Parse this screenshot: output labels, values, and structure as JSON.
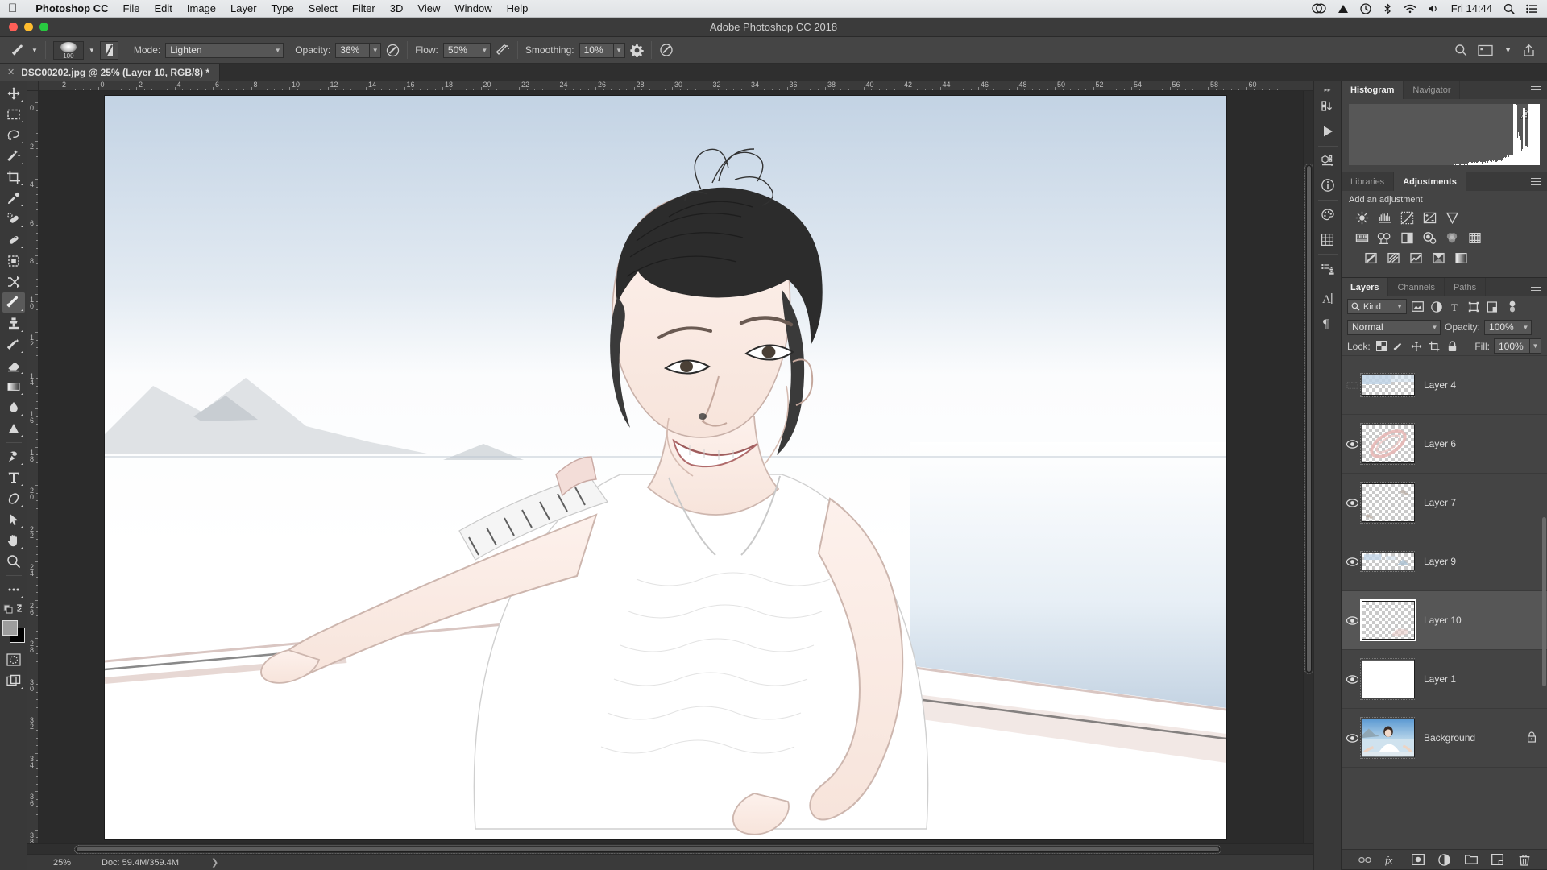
{
  "macmenu": {
    "apple_icon": "apple-icon",
    "app_name": "Photoshop CC",
    "items": [
      "File",
      "Edit",
      "Image",
      "Layer",
      "Type",
      "Select",
      "Filter",
      "3D",
      "View",
      "Window",
      "Help"
    ],
    "status_icons": [
      "creative-cloud-icon",
      "dropbox-icon",
      "time-machine-icon",
      "bluetooth-icon",
      "wifi-icon",
      "volume-icon"
    ],
    "clock": "Fri 14:44",
    "search_icon": "spotlight-search-icon",
    "list_icon": "notification-center-icon"
  },
  "titlebar": {
    "title": "Adobe Photoshop CC 2018",
    "close": "close-button",
    "minimize": "minimize-button",
    "maximize": "maximize-button"
  },
  "optionsbar": {
    "tool_icon": "brush-tool-icon",
    "brush_size": "100",
    "mode_label": "Mode:",
    "mode_value": "Lighten",
    "opacity_label": "Opacity:",
    "opacity_value": "36%",
    "flow_label": "Flow:",
    "flow_value": "50%",
    "smoothing_label": "Smoothing:",
    "smoothing_value": "10%",
    "airbrush_icon": "airbrush-icon",
    "pressure_opacity_icon": "pressure-opacity-icon",
    "pressure_size_icon": "pressure-size-icon",
    "smoothing_options_icon": "gear-icon",
    "symmetry_icon": "symmetry-icon",
    "search_icon": "search-icon",
    "workspace_icon": "workspace-switcher-icon",
    "share_icon": "share-icon"
  },
  "doctab": {
    "close_icon": "close-tab-icon",
    "title": "DSC00202.jpg @ 25% (Layer 10, RGB/8) *"
  },
  "toolbar": {
    "tools": [
      {
        "name": "move-tool",
        "icon": "move-icon",
        "selected": false,
        "has_flyout": true
      },
      {
        "name": "rectangular-marquee-tool",
        "icon": "marquee-icon",
        "selected": false,
        "has_flyout": true
      },
      {
        "name": "lasso-tool",
        "icon": "lasso-icon",
        "selected": false,
        "has_flyout": true
      },
      {
        "name": "quick-selection-tool",
        "icon": "magic-wand-icon",
        "selected": false,
        "has_flyout": true
      },
      {
        "name": "crop-tool",
        "icon": "crop-icon",
        "selected": false,
        "has_flyout": true
      },
      {
        "name": "eyedropper-tool",
        "icon": "eyedropper-icon",
        "selected": false,
        "has_flyout": true
      },
      {
        "name": "spot-healing-brush-tool",
        "icon": "healing-brush-icon",
        "selected": false,
        "has_flyout": true
      },
      {
        "name": "patch-tool",
        "icon": "patch-icon",
        "selected": false,
        "has_flyout": true
      },
      {
        "name": "frame-tool",
        "icon": "frame-icon",
        "selected": false,
        "has_flyout": false
      },
      {
        "name": "shuffle-tool",
        "icon": "shuffle-icon",
        "selected": false,
        "has_flyout": false
      },
      {
        "name": "brush-tool",
        "icon": "brush-icon",
        "selected": true,
        "has_flyout": true
      },
      {
        "name": "clone-stamp-tool",
        "icon": "clone-stamp-icon",
        "selected": false,
        "has_flyout": true
      },
      {
        "name": "history-brush-tool",
        "icon": "history-brush-icon",
        "selected": false,
        "has_flyout": true
      },
      {
        "name": "eraser-tool",
        "icon": "eraser-icon",
        "selected": false,
        "has_flyout": true
      },
      {
        "name": "gradient-tool",
        "icon": "gradient-icon",
        "selected": false,
        "has_flyout": true
      },
      {
        "name": "blur-tool",
        "icon": "blur-droplet-icon",
        "selected": false,
        "has_flyout": true
      },
      {
        "name": "dodge-tool",
        "icon": "dodge-icon",
        "selected": false,
        "has_flyout": true
      },
      {
        "name": "pen-tool",
        "icon": "pen-icon",
        "selected": false,
        "has_flyout": true
      },
      {
        "name": "type-tool",
        "icon": "type-t-icon",
        "selected": false,
        "has_flyout": true
      },
      {
        "name": "path-selection-tool",
        "icon": "path-shape-icon",
        "selected": false,
        "has_flyout": true
      },
      {
        "name": "direct-selection-tool",
        "icon": "arrow-cursor-icon",
        "selected": false,
        "has_flyout": true
      },
      {
        "name": "hand-tool",
        "icon": "hand-icon",
        "selected": false,
        "has_flyout": true
      },
      {
        "name": "zoom-tool",
        "icon": "magnifier-icon",
        "selected": false,
        "has_flyout": false
      },
      {
        "name": "edit-toolbar",
        "icon": "ellipsis-icon",
        "selected": false,
        "has_flyout": true
      }
    ],
    "foreground_color": "#9d9d9d",
    "background_color": "#000000",
    "default_colors_icon": "default-colors-icon",
    "swap_colors_icon": "swap-colors-icon",
    "quick_mask_icon": "quick-mask-icon",
    "screen_mode_icon": "screen-mode-icon"
  },
  "rulers": {
    "horizontal_labels": [
      "2",
      "0",
      "2",
      "4",
      "6",
      "8",
      "10",
      "12",
      "14",
      "16",
      "18",
      "20",
      "22",
      "24",
      "26",
      "28",
      "30",
      "32",
      "34",
      "36",
      "38",
      "40",
      "42",
      "44",
      "46",
      "48",
      "50",
      "52",
      "54",
      "56",
      "58",
      "60"
    ],
    "vertical_labels": [
      "0",
      "2",
      "4",
      "6",
      "8",
      "10",
      "12",
      "14",
      "16",
      "18",
      "20",
      "22",
      "24",
      "26",
      "28",
      "30",
      "32",
      "34",
      "36",
      "38"
    ]
  },
  "statusbar": {
    "zoom": "25%",
    "doc_info": "Doc: 59.4M/359.4M",
    "arrow_icon": "chevron-right-icon"
  },
  "dockrail": {
    "icons": [
      {
        "name": "history-panel-icon"
      },
      {
        "name": "actions-play-icon"
      },
      {
        "name": "3d-panel-icon"
      },
      {
        "name": "info-panel-icon"
      },
      {
        "name": "color-swatches-icon"
      },
      {
        "name": "swatches-grid-icon"
      },
      {
        "name": "clone-source-icon"
      },
      {
        "name": "character-panel-icon"
      },
      {
        "name": "paragraph-panel-icon"
      }
    ],
    "collapse_icon": "collapse-panels-icon"
  },
  "histogram_panel": {
    "tabs": [
      {
        "label": "Histogram",
        "active": true
      },
      {
        "label": "Navigator",
        "active": false
      }
    ],
    "menu_icon": "panel-menu-icon",
    "warning_icon": "cached-data-warning-icon"
  },
  "adjustments_panel": {
    "tabs": [
      {
        "label": "Libraries",
        "active": false
      },
      {
        "label": "Adjustments",
        "active": true
      }
    ],
    "menu_icon": "panel-menu-icon",
    "title": "Add an adjustment",
    "rows": [
      [
        {
          "name": "brightness-contrast-adjustment",
          "icon": "brightness-icon"
        },
        {
          "name": "levels-adjustment",
          "icon": "levels-icon"
        },
        {
          "name": "curves-adjustment",
          "icon": "curves-icon"
        },
        {
          "name": "exposure-adjustment",
          "icon": "exposure-icon"
        },
        {
          "name": "vibrance-adjustment",
          "icon": "vibrance-icon"
        }
      ],
      [
        {
          "name": "hue-saturation-adjustment",
          "icon": "hue-saturation-icon"
        },
        {
          "name": "color-balance-adjustment",
          "icon": "color-balance-icon"
        },
        {
          "name": "black-white-adjustment",
          "icon": "black-white-icon"
        },
        {
          "name": "photo-filter-adjustment",
          "icon": "photo-filter-icon"
        },
        {
          "name": "channel-mixer-adjustment",
          "icon": "channel-mixer-icon"
        },
        {
          "name": "color-lookup-adjustment",
          "icon": "color-lookup-icon"
        }
      ],
      [
        {
          "name": "invert-adjustment",
          "icon": "invert-icon"
        },
        {
          "name": "posterize-adjustment",
          "icon": "posterize-icon"
        },
        {
          "name": "threshold-adjustment",
          "icon": "threshold-icon"
        },
        {
          "name": "selective-color-adjustment",
          "icon": "selective-color-icon"
        },
        {
          "name": "gradient-map-adjustment",
          "icon": "gradient-map-icon"
        }
      ]
    ]
  },
  "layers_panel": {
    "tabs": [
      {
        "label": "Layers",
        "active": true
      },
      {
        "label": "Channels",
        "active": false
      },
      {
        "label": "Paths",
        "active": false
      }
    ],
    "menu_icon": "panel-menu-icon",
    "filter": {
      "search_icon": "search-icon",
      "kind_label": "Kind",
      "chevron": "chevron-down-icon",
      "filter_icons": [
        {
          "name": "filter-pixel-icon"
        },
        {
          "name": "filter-adjustment-icon"
        },
        {
          "name": "filter-type-icon"
        },
        {
          "name": "filter-shape-icon"
        },
        {
          "name": "filter-smart-object-icon"
        }
      ],
      "toggle_icon": "filter-toggle-icon"
    },
    "blend_mode": "Normal",
    "opacity_label": "Opacity:",
    "opacity_value": "100%",
    "lock_label": "Lock:",
    "lock_icons": [
      {
        "name": "lock-transparent-pixels-icon"
      },
      {
        "name": "lock-image-pixels-icon"
      },
      {
        "name": "lock-position-icon"
      },
      {
        "name": "lock-artboard-nesting-icon"
      },
      {
        "name": "lock-all-icon"
      }
    ],
    "fill_label": "Fill:",
    "fill_value": "100%",
    "layers": [
      {
        "name": "Layer 4",
        "visible": false,
        "selected": false,
        "thumb": "transparent-sky",
        "locked": false
      },
      {
        "name": "Layer 6",
        "visible": true,
        "selected": false,
        "thumb": "transparent-pink-stroke",
        "locked": false
      },
      {
        "name": "Layer 7",
        "visible": true,
        "selected": false,
        "thumb": "transparent-specks",
        "locked": false
      },
      {
        "name": "Layer 9",
        "visible": true,
        "selected": false,
        "thumb": "transparent-thin-sky",
        "locked": false
      },
      {
        "name": "Layer 10",
        "visible": true,
        "selected": true,
        "thumb": "transparent-faint-pink",
        "locked": false
      },
      {
        "name": "Layer 1",
        "visible": true,
        "selected": false,
        "thumb": "white-fill",
        "locked": false
      },
      {
        "name": "Background",
        "visible": true,
        "selected": false,
        "thumb": "photo-portrait",
        "locked": true
      }
    ],
    "footer_icons": [
      {
        "name": "link-layers-button"
      },
      {
        "name": "layer-style-fx-button"
      },
      {
        "name": "add-layer-mask-button"
      },
      {
        "name": "new-adjustment-layer-button"
      },
      {
        "name": "new-group-button"
      },
      {
        "name": "new-layer-button"
      },
      {
        "name": "delete-layer-button"
      }
    ]
  }
}
